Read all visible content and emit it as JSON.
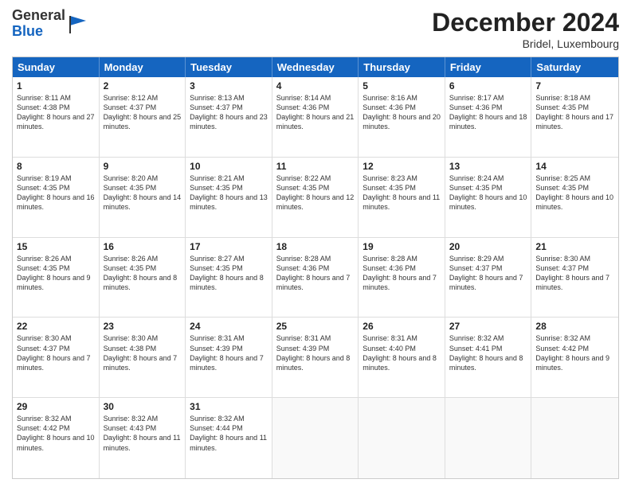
{
  "header": {
    "logo_general": "General",
    "logo_blue": "Blue",
    "month_title": "December 2024",
    "location": "Bridel, Luxembourg"
  },
  "days_of_week": [
    "Sunday",
    "Monday",
    "Tuesday",
    "Wednesday",
    "Thursday",
    "Friday",
    "Saturday"
  ],
  "weeks": [
    [
      {
        "day": "1",
        "sunrise": "Sunrise: 8:11 AM",
        "sunset": "Sunset: 4:38 PM",
        "daylight": "Daylight: 8 hours and 27 minutes."
      },
      {
        "day": "2",
        "sunrise": "Sunrise: 8:12 AM",
        "sunset": "Sunset: 4:37 PM",
        "daylight": "Daylight: 8 hours and 25 minutes."
      },
      {
        "day": "3",
        "sunrise": "Sunrise: 8:13 AM",
        "sunset": "Sunset: 4:37 PM",
        "daylight": "Daylight: 8 hours and 23 minutes."
      },
      {
        "day": "4",
        "sunrise": "Sunrise: 8:14 AM",
        "sunset": "Sunset: 4:36 PM",
        "daylight": "Daylight: 8 hours and 21 minutes."
      },
      {
        "day": "5",
        "sunrise": "Sunrise: 8:16 AM",
        "sunset": "Sunset: 4:36 PM",
        "daylight": "Daylight: 8 hours and 20 minutes."
      },
      {
        "day": "6",
        "sunrise": "Sunrise: 8:17 AM",
        "sunset": "Sunset: 4:36 PM",
        "daylight": "Daylight: 8 hours and 18 minutes."
      },
      {
        "day": "7",
        "sunrise": "Sunrise: 8:18 AM",
        "sunset": "Sunset: 4:35 PM",
        "daylight": "Daylight: 8 hours and 17 minutes."
      }
    ],
    [
      {
        "day": "8",
        "sunrise": "Sunrise: 8:19 AM",
        "sunset": "Sunset: 4:35 PM",
        "daylight": "Daylight: 8 hours and 16 minutes."
      },
      {
        "day": "9",
        "sunrise": "Sunrise: 8:20 AM",
        "sunset": "Sunset: 4:35 PM",
        "daylight": "Daylight: 8 hours and 14 minutes."
      },
      {
        "day": "10",
        "sunrise": "Sunrise: 8:21 AM",
        "sunset": "Sunset: 4:35 PM",
        "daylight": "Daylight: 8 hours and 13 minutes."
      },
      {
        "day": "11",
        "sunrise": "Sunrise: 8:22 AM",
        "sunset": "Sunset: 4:35 PM",
        "daylight": "Daylight: 8 hours and 12 minutes."
      },
      {
        "day": "12",
        "sunrise": "Sunrise: 8:23 AM",
        "sunset": "Sunset: 4:35 PM",
        "daylight": "Daylight: 8 hours and 11 minutes."
      },
      {
        "day": "13",
        "sunrise": "Sunrise: 8:24 AM",
        "sunset": "Sunset: 4:35 PM",
        "daylight": "Daylight: 8 hours and 10 minutes."
      },
      {
        "day": "14",
        "sunrise": "Sunrise: 8:25 AM",
        "sunset": "Sunset: 4:35 PM",
        "daylight": "Daylight: 8 hours and 10 minutes."
      }
    ],
    [
      {
        "day": "15",
        "sunrise": "Sunrise: 8:26 AM",
        "sunset": "Sunset: 4:35 PM",
        "daylight": "Daylight: 8 hours and 9 minutes."
      },
      {
        "day": "16",
        "sunrise": "Sunrise: 8:26 AM",
        "sunset": "Sunset: 4:35 PM",
        "daylight": "Daylight: 8 hours and 8 minutes."
      },
      {
        "day": "17",
        "sunrise": "Sunrise: 8:27 AM",
        "sunset": "Sunset: 4:35 PM",
        "daylight": "Daylight: 8 hours and 8 minutes."
      },
      {
        "day": "18",
        "sunrise": "Sunrise: 8:28 AM",
        "sunset": "Sunset: 4:36 PM",
        "daylight": "Daylight: 8 hours and 7 minutes."
      },
      {
        "day": "19",
        "sunrise": "Sunrise: 8:28 AM",
        "sunset": "Sunset: 4:36 PM",
        "daylight": "Daylight: 8 hours and 7 minutes."
      },
      {
        "day": "20",
        "sunrise": "Sunrise: 8:29 AM",
        "sunset": "Sunset: 4:37 PM",
        "daylight": "Daylight: 8 hours and 7 minutes."
      },
      {
        "day": "21",
        "sunrise": "Sunrise: 8:30 AM",
        "sunset": "Sunset: 4:37 PM",
        "daylight": "Daylight: 8 hours and 7 minutes."
      }
    ],
    [
      {
        "day": "22",
        "sunrise": "Sunrise: 8:30 AM",
        "sunset": "Sunset: 4:37 PM",
        "daylight": "Daylight: 8 hours and 7 minutes."
      },
      {
        "day": "23",
        "sunrise": "Sunrise: 8:30 AM",
        "sunset": "Sunset: 4:38 PM",
        "daylight": "Daylight: 8 hours and 7 minutes."
      },
      {
        "day": "24",
        "sunrise": "Sunrise: 8:31 AM",
        "sunset": "Sunset: 4:39 PM",
        "daylight": "Daylight: 8 hours and 7 minutes."
      },
      {
        "day": "25",
        "sunrise": "Sunrise: 8:31 AM",
        "sunset": "Sunset: 4:39 PM",
        "daylight": "Daylight: 8 hours and 8 minutes."
      },
      {
        "day": "26",
        "sunrise": "Sunrise: 8:31 AM",
        "sunset": "Sunset: 4:40 PM",
        "daylight": "Daylight: 8 hours and 8 minutes."
      },
      {
        "day": "27",
        "sunrise": "Sunrise: 8:32 AM",
        "sunset": "Sunset: 4:41 PM",
        "daylight": "Daylight: 8 hours and 8 minutes."
      },
      {
        "day": "28",
        "sunrise": "Sunrise: 8:32 AM",
        "sunset": "Sunset: 4:42 PM",
        "daylight": "Daylight: 8 hours and 9 minutes."
      }
    ],
    [
      {
        "day": "29",
        "sunrise": "Sunrise: 8:32 AM",
        "sunset": "Sunset: 4:42 PM",
        "daylight": "Daylight: 8 hours and 10 minutes."
      },
      {
        "day": "30",
        "sunrise": "Sunrise: 8:32 AM",
        "sunset": "Sunset: 4:43 PM",
        "daylight": "Daylight: 8 hours and 11 minutes."
      },
      {
        "day": "31",
        "sunrise": "Sunrise: 8:32 AM",
        "sunset": "Sunset: 4:44 PM",
        "daylight": "Daylight: 8 hours and 11 minutes."
      },
      {
        "day": "",
        "sunrise": "",
        "sunset": "",
        "daylight": ""
      },
      {
        "day": "",
        "sunrise": "",
        "sunset": "",
        "daylight": ""
      },
      {
        "day": "",
        "sunrise": "",
        "sunset": "",
        "daylight": ""
      },
      {
        "day": "",
        "sunrise": "",
        "sunset": "",
        "daylight": ""
      }
    ]
  ]
}
